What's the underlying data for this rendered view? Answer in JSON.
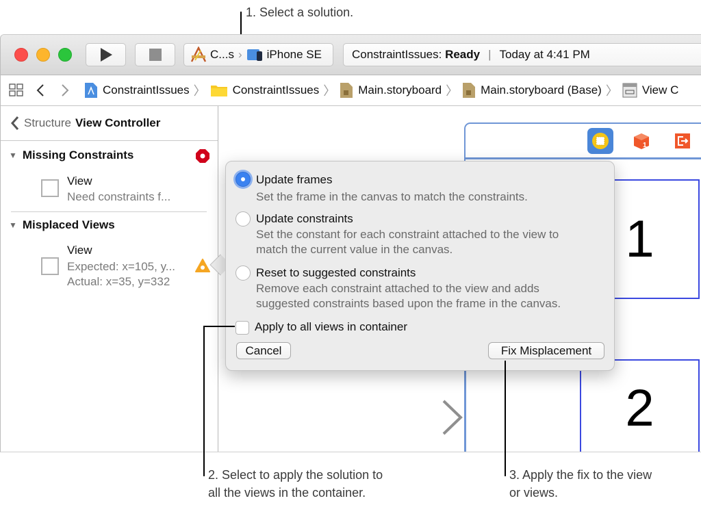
{
  "callouts": {
    "one": "1. Select a solution.",
    "two_line1": "2. Select to apply the solution to",
    "two_line2": "all the views in the container.",
    "three_line1": "3. Apply the fix to the view",
    "three_line2": "or views."
  },
  "toolbar": {
    "scheme_name": "C...s",
    "scheme_separator": "›",
    "destination": "iPhone SE",
    "status_project": "ConstraintIssues: ",
    "status_state": "Ready",
    "status_separator": "|",
    "status_time": "Today at 4:41 PM"
  },
  "jumpbar": {
    "crumbs": [
      {
        "label": "ConstraintIssues",
        "icon": "project-icon"
      },
      {
        "label": "ConstraintIssues",
        "icon": "folder-icon"
      },
      {
        "label": "Main.storyboard",
        "icon": "storyboard-icon"
      },
      {
        "label": "Main.storyboard (Base)",
        "icon": "storyboard-icon"
      },
      {
        "label": "View C",
        "icon": "view-controller-icon"
      }
    ],
    "separator": "〉"
  },
  "sidebar": {
    "back_label": "Structure",
    "title": "View Controller",
    "sections": [
      {
        "title": "Missing Constraints",
        "status": "error",
        "items": [
          {
            "title": "View",
            "lines": [
              "Need constraints f..."
            ]
          }
        ]
      },
      {
        "title": "Misplaced Views",
        "status": "warning",
        "items": [
          {
            "title": "View",
            "lines": [
              "Expected: x=105, y...",
              "Actual: x=35, y=332"
            ]
          }
        ]
      }
    ]
  },
  "canvas": {
    "label_box1": "1",
    "label_box2": "2"
  },
  "popover": {
    "options": [
      {
        "title": "Update frames",
        "desc": [
          "Set the frame in the canvas to match the constraints."
        ],
        "selected": true
      },
      {
        "title": "Update constraints",
        "desc": [
          "Set the constant for each constraint attached to the view to",
          "match the current value in the canvas."
        ],
        "selected": false
      },
      {
        "title": "Reset to suggested constraints",
        "desc": [
          "Remove each constraint attached to the view and adds",
          "suggested constraints based upon the frame in the canvas."
        ],
        "selected": false
      }
    ],
    "apply_all_label": "Apply to all views in container",
    "apply_all_checked": false,
    "cancel_label": "Cancel",
    "fix_label": "Fix Misplacement"
  },
  "colors": {
    "accent": "#3b82f0",
    "error": "#d0021b",
    "warning": "#f5a623",
    "constraint_blue": "#3b49e0"
  }
}
